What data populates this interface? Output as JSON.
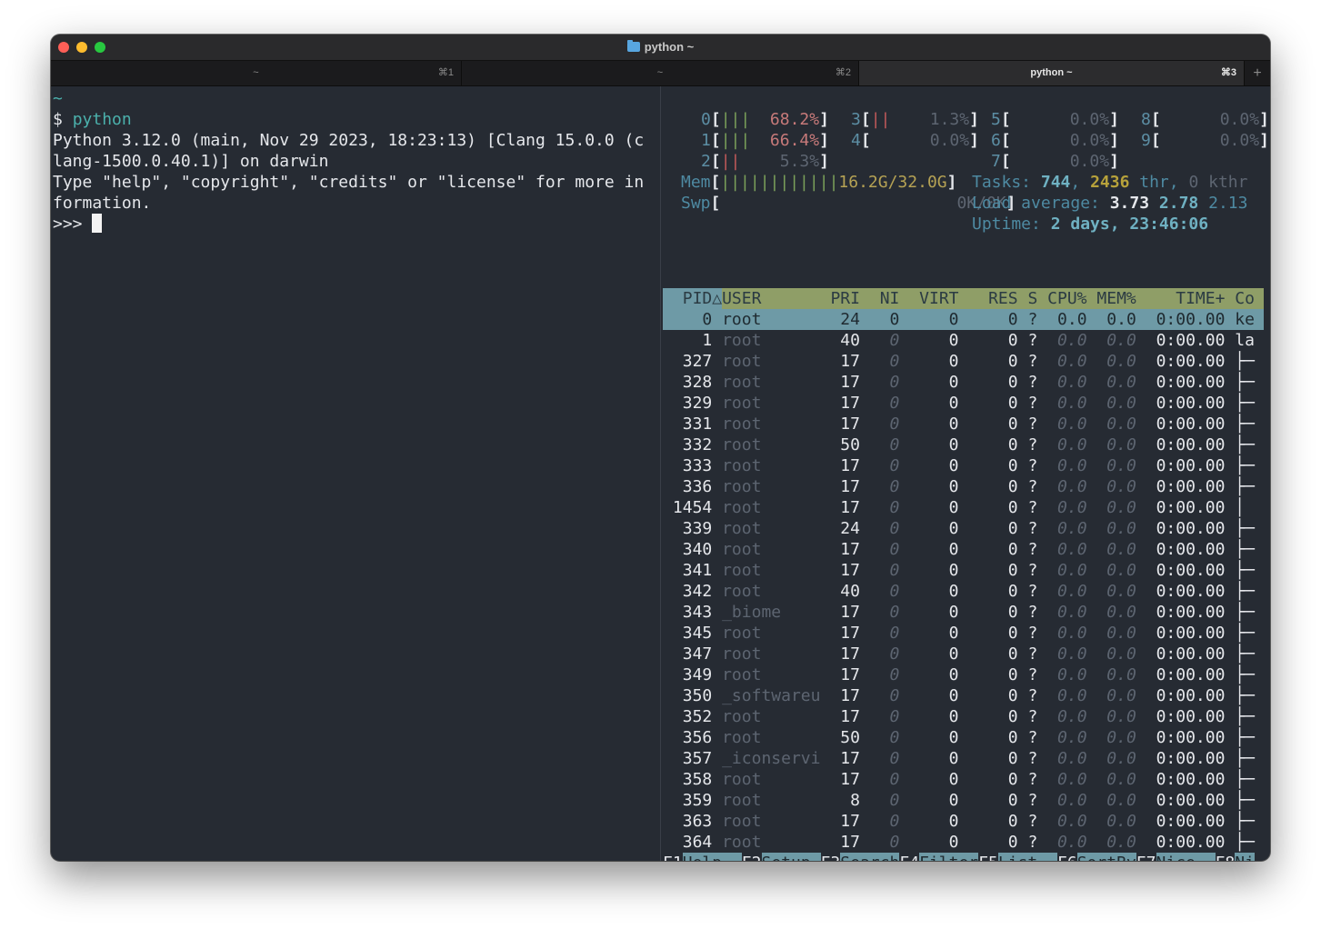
{
  "window": {
    "title": "python ~"
  },
  "tabs": [
    {
      "label": "~",
      "shortcut": "⌘1"
    },
    {
      "label": "~",
      "shortcut": "⌘2"
    },
    {
      "label": "python ~",
      "shortcut": "⌘3"
    }
  ],
  "tab_add": "+",
  "left_terminal": {
    "lines": [
      "~",
      "$ ",
      "Python 3.12.0 (main, Nov 29 2023, 18:23:13) [Clang 15.0.0 (c",
      "lang-1500.0.40.1)] on darwin",
      "Type \"help\", \"copyright\", \"credits\" or \"license\" for more in",
      "formation.",
      ">>> "
    ],
    "command": "python"
  },
  "htop": {
    "cpus": [
      {
        "id": "0",
        "bars": "|||",
        "value": "68.2%"
      },
      {
        "id": "1",
        "bars": "|||",
        "value": "66.4%"
      },
      {
        "id": "2",
        "bars": "||",
        "value": "5.3%"
      },
      {
        "id": "3",
        "bars": "||",
        "value": "1.3%"
      },
      {
        "id": "4",
        "bars": "",
        "value": "0.0%"
      },
      {
        "id": "5",
        "bars": "",
        "value": "0.0%"
      },
      {
        "id": "6",
        "bars": "",
        "value": "0.0%"
      },
      {
        "id": "7",
        "bars": "",
        "value": "0.0%"
      },
      {
        "id": "8",
        "bars": "",
        "value": "0.0%"
      },
      {
        "id": "9",
        "bars": "",
        "value": "0.0%"
      }
    ],
    "mem": {
      "label": "Mem",
      "bars": "||||||||||||",
      "value": "16.2G/32.0G"
    },
    "swp": {
      "label": "Swp",
      "value": "0K/0K"
    },
    "tasks": {
      "label": "Tasks: ",
      "count": "744",
      "sep": ", ",
      "threads": "2436",
      "thr": " thr, ",
      "kthr_count": "0",
      "kthr": " kthr"
    },
    "load": {
      "label": "Load average: ",
      "l1": "3.73",
      "l5": "2.78",
      "l15": "2.13"
    },
    "uptime": {
      "label": "Uptime: ",
      "value": "2 days, 23:46:06"
    },
    "columns": [
      "PID△",
      "USER",
      "PRI",
      "NI",
      "VIRT",
      "RES",
      "S",
      "CPU%",
      "MEM%",
      "TIME+",
      "Co"
    ],
    "processes": [
      {
        "pid": "0",
        "user": "root",
        "pri": "24",
        "ni": "0",
        "virt": "0",
        "res": "0",
        "s": "?",
        "cpu": "0.0",
        "mem": "0.0",
        "time": "0:00.00",
        "cmd": "ke",
        "selected": true
      },
      {
        "pid": "1",
        "user": "root",
        "pri": "40",
        "ni": "0",
        "virt": "0",
        "res": "0",
        "s": "?",
        "cpu": "0.0",
        "mem": "0.0",
        "time": "0:00.00",
        "cmd": "la"
      },
      {
        "pid": "327",
        "user": "root",
        "pri": "17",
        "ni": "0",
        "virt": "0",
        "res": "0",
        "s": "?",
        "cpu": "0.0",
        "mem": "0.0",
        "time": "0:00.00",
        "cmd": "├─"
      },
      {
        "pid": "328",
        "user": "root",
        "pri": "17",
        "ni": "0",
        "virt": "0",
        "res": "0",
        "s": "?",
        "cpu": "0.0",
        "mem": "0.0",
        "time": "0:00.00",
        "cmd": "├─"
      },
      {
        "pid": "329",
        "user": "root",
        "pri": "17",
        "ni": "0",
        "virt": "0",
        "res": "0",
        "s": "?",
        "cpu": "0.0",
        "mem": "0.0",
        "time": "0:00.00",
        "cmd": "├─"
      },
      {
        "pid": "331",
        "user": "root",
        "pri": "17",
        "ni": "0",
        "virt": "0",
        "res": "0",
        "s": "?",
        "cpu": "0.0",
        "mem": "0.0",
        "time": "0:00.00",
        "cmd": "├─"
      },
      {
        "pid": "332",
        "user": "root",
        "pri": "50",
        "ni": "0",
        "virt": "0",
        "res": "0",
        "s": "?",
        "cpu": "0.0",
        "mem": "0.0",
        "time": "0:00.00",
        "cmd": "├─"
      },
      {
        "pid": "333",
        "user": "root",
        "pri": "17",
        "ni": "0",
        "virt": "0",
        "res": "0",
        "s": "?",
        "cpu": "0.0",
        "mem": "0.0",
        "time": "0:00.00",
        "cmd": "├─"
      },
      {
        "pid": "336",
        "user": "root",
        "pri": "17",
        "ni": "0",
        "virt": "0",
        "res": "0",
        "s": "?",
        "cpu": "0.0",
        "mem": "0.0",
        "time": "0:00.00",
        "cmd": "├─"
      },
      {
        "pid": "1454",
        "user": "root",
        "pri": "17",
        "ni": "0",
        "virt": "0",
        "res": "0",
        "s": "?",
        "cpu": "0.0",
        "mem": "0.0",
        "time": "0:00.00",
        "cmd": "│"
      },
      {
        "pid": "339",
        "user": "root",
        "pri": "24",
        "ni": "0",
        "virt": "0",
        "res": "0",
        "s": "?",
        "cpu": "0.0",
        "mem": "0.0",
        "time": "0:00.00",
        "cmd": "├─"
      },
      {
        "pid": "340",
        "user": "root",
        "pri": "17",
        "ni": "0",
        "virt": "0",
        "res": "0",
        "s": "?",
        "cpu": "0.0",
        "mem": "0.0",
        "time": "0:00.00",
        "cmd": "├─"
      },
      {
        "pid": "341",
        "user": "root",
        "pri": "17",
        "ni": "0",
        "virt": "0",
        "res": "0",
        "s": "?",
        "cpu": "0.0",
        "mem": "0.0",
        "time": "0:00.00",
        "cmd": "├─"
      },
      {
        "pid": "342",
        "user": "root",
        "pri": "40",
        "ni": "0",
        "virt": "0",
        "res": "0",
        "s": "?",
        "cpu": "0.0",
        "mem": "0.0",
        "time": "0:00.00",
        "cmd": "├─"
      },
      {
        "pid": "343",
        "user": "_biome",
        "pri": "17",
        "ni": "0",
        "virt": "0",
        "res": "0",
        "s": "?",
        "cpu": "0.0",
        "mem": "0.0",
        "time": "0:00.00",
        "cmd": "├─"
      },
      {
        "pid": "345",
        "user": "root",
        "pri": "17",
        "ni": "0",
        "virt": "0",
        "res": "0",
        "s": "?",
        "cpu": "0.0",
        "mem": "0.0",
        "time": "0:00.00",
        "cmd": "├─"
      },
      {
        "pid": "347",
        "user": "root",
        "pri": "17",
        "ni": "0",
        "virt": "0",
        "res": "0",
        "s": "?",
        "cpu": "0.0",
        "mem": "0.0",
        "time": "0:00.00",
        "cmd": "├─"
      },
      {
        "pid": "349",
        "user": "root",
        "pri": "17",
        "ni": "0",
        "virt": "0",
        "res": "0",
        "s": "?",
        "cpu": "0.0",
        "mem": "0.0",
        "time": "0:00.00",
        "cmd": "├─"
      },
      {
        "pid": "350",
        "user": "_softwareu",
        "pri": "17",
        "ni": "0",
        "virt": "0",
        "res": "0",
        "s": "?",
        "cpu": "0.0",
        "mem": "0.0",
        "time": "0:00.00",
        "cmd": "├─"
      },
      {
        "pid": "352",
        "user": "root",
        "pri": "17",
        "ni": "0",
        "virt": "0",
        "res": "0",
        "s": "?",
        "cpu": "0.0",
        "mem": "0.0",
        "time": "0:00.00",
        "cmd": "├─"
      },
      {
        "pid": "356",
        "user": "root",
        "pri": "50",
        "ni": "0",
        "virt": "0",
        "res": "0",
        "s": "?",
        "cpu": "0.0",
        "mem": "0.0",
        "time": "0:00.00",
        "cmd": "├─"
      },
      {
        "pid": "357",
        "user": "_iconservi",
        "pri": "17",
        "ni": "0",
        "virt": "0",
        "res": "0",
        "s": "?",
        "cpu": "0.0",
        "mem": "0.0",
        "time": "0:00.00",
        "cmd": "├─"
      },
      {
        "pid": "358",
        "user": "root",
        "pri": "17",
        "ni": "0",
        "virt": "0",
        "res": "0",
        "s": "?",
        "cpu": "0.0",
        "mem": "0.0",
        "time": "0:00.00",
        "cmd": "├─"
      },
      {
        "pid": "359",
        "user": "root",
        "pri": "8",
        "ni": "0",
        "virt": "0",
        "res": "0",
        "s": "?",
        "cpu": "0.0",
        "mem": "0.0",
        "time": "0:00.00",
        "cmd": "├─"
      },
      {
        "pid": "363",
        "user": "root",
        "pri": "17",
        "ni": "0",
        "virt": "0",
        "res": "0",
        "s": "?",
        "cpu": "0.0",
        "mem": "0.0",
        "time": "0:00.00",
        "cmd": "├─"
      },
      {
        "pid": "364",
        "user": "root",
        "pri": "17",
        "ni": "0",
        "virt": "0",
        "res": "0",
        "s": "?",
        "cpu": "0.0",
        "mem": "0.0",
        "time": "0:00.00",
        "cmd": "├─"
      }
    ],
    "function_keys": [
      {
        "key": "F1",
        "action": "Help  "
      },
      {
        "key": "F2",
        "action": "Setup "
      },
      {
        "key": "F3",
        "action": "Search"
      },
      {
        "key": "F4",
        "action": "Filter"
      },
      {
        "key": "F5",
        "action": "List  "
      },
      {
        "key": "F6",
        "action": "SortBy"
      },
      {
        "key": "F7",
        "action": "Nice -"
      },
      {
        "key": "F8",
        "action": "Ni"
      }
    ]
  }
}
